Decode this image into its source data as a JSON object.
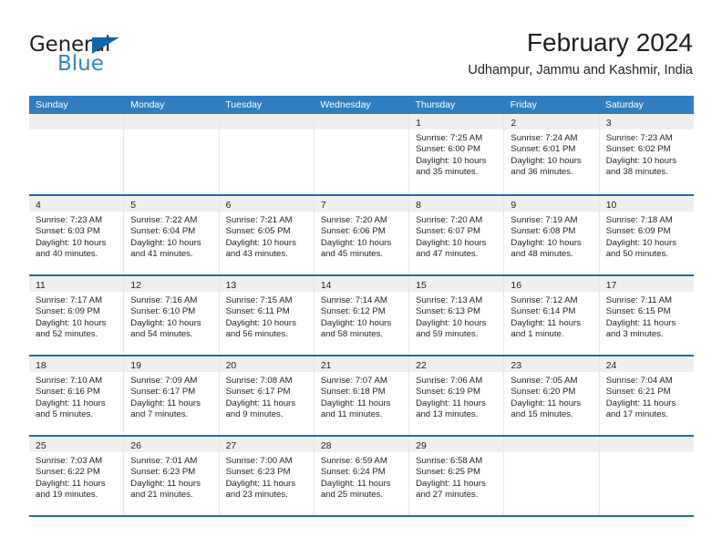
{
  "brand": {
    "name_top": "General",
    "name_bottom": "Blue",
    "triangle_color": "#1265a8",
    "blue_text_color": "#2a86d4"
  },
  "header": {
    "title": "February 2024",
    "subtitle": "Udhampur, Jammu and Kashmir, India"
  },
  "theme": {
    "header_bar": "#2f7ec1",
    "row_rule": "#1f6cb4",
    "day_head_bg": "#efefef",
    "text": "#231f20"
  },
  "weekdays": [
    "Sunday",
    "Monday",
    "Tuesday",
    "Wednesday",
    "Thursday",
    "Friday",
    "Saturday"
  ],
  "weeks": [
    [
      {
        "day": "",
        "lines": []
      },
      {
        "day": "",
        "lines": []
      },
      {
        "day": "",
        "lines": []
      },
      {
        "day": "",
        "lines": []
      },
      {
        "day": "1",
        "lines": [
          "Sunrise: 7:25 AM",
          "Sunset: 6:00 PM",
          "Daylight: 10 hours",
          "and 35 minutes."
        ]
      },
      {
        "day": "2",
        "lines": [
          "Sunrise: 7:24 AM",
          "Sunset: 6:01 PM",
          "Daylight: 10 hours",
          "and 36 minutes."
        ]
      },
      {
        "day": "3",
        "lines": [
          "Sunrise: 7:23 AM",
          "Sunset: 6:02 PM",
          "Daylight: 10 hours",
          "and 38 minutes."
        ]
      }
    ],
    [
      {
        "day": "4",
        "lines": [
          "Sunrise: 7:23 AM",
          "Sunset: 6:03 PM",
          "Daylight: 10 hours",
          "and 40 minutes."
        ]
      },
      {
        "day": "5",
        "lines": [
          "Sunrise: 7:22 AM",
          "Sunset: 6:04 PM",
          "Daylight: 10 hours",
          "and 41 minutes."
        ]
      },
      {
        "day": "6",
        "lines": [
          "Sunrise: 7:21 AM",
          "Sunset: 6:05 PM",
          "Daylight: 10 hours",
          "and 43 minutes."
        ]
      },
      {
        "day": "7",
        "lines": [
          "Sunrise: 7:20 AM",
          "Sunset: 6:06 PM",
          "Daylight: 10 hours",
          "and 45 minutes."
        ]
      },
      {
        "day": "8",
        "lines": [
          "Sunrise: 7:20 AM",
          "Sunset: 6:07 PM",
          "Daylight: 10 hours",
          "and 47 minutes."
        ]
      },
      {
        "day": "9",
        "lines": [
          "Sunrise: 7:19 AM",
          "Sunset: 6:08 PM",
          "Daylight: 10 hours",
          "and 48 minutes."
        ]
      },
      {
        "day": "10",
        "lines": [
          "Sunrise: 7:18 AM",
          "Sunset: 6:09 PM",
          "Daylight: 10 hours",
          "and 50 minutes."
        ]
      }
    ],
    [
      {
        "day": "11",
        "lines": [
          "Sunrise: 7:17 AM",
          "Sunset: 6:09 PM",
          "Daylight: 10 hours",
          "and 52 minutes."
        ]
      },
      {
        "day": "12",
        "lines": [
          "Sunrise: 7:16 AM",
          "Sunset: 6:10 PM",
          "Daylight: 10 hours",
          "and 54 minutes."
        ]
      },
      {
        "day": "13",
        "lines": [
          "Sunrise: 7:15 AM",
          "Sunset: 6:11 PM",
          "Daylight: 10 hours",
          "and 56 minutes."
        ]
      },
      {
        "day": "14",
        "lines": [
          "Sunrise: 7:14 AM",
          "Sunset: 6:12 PM",
          "Daylight: 10 hours",
          "and 58 minutes."
        ]
      },
      {
        "day": "15",
        "lines": [
          "Sunrise: 7:13 AM",
          "Sunset: 6:13 PM",
          "Daylight: 10 hours",
          "and 59 minutes."
        ]
      },
      {
        "day": "16",
        "lines": [
          "Sunrise: 7:12 AM",
          "Sunset: 6:14 PM",
          "Daylight: 11 hours",
          "and 1 minute."
        ]
      },
      {
        "day": "17",
        "lines": [
          "Sunrise: 7:11 AM",
          "Sunset: 6:15 PM",
          "Daylight: 11 hours",
          "and 3 minutes."
        ]
      }
    ],
    [
      {
        "day": "18",
        "lines": [
          "Sunrise: 7:10 AM",
          "Sunset: 6:16 PM",
          "Daylight: 11 hours",
          "and 5 minutes."
        ]
      },
      {
        "day": "19",
        "lines": [
          "Sunrise: 7:09 AM",
          "Sunset: 6:17 PM",
          "Daylight: 11 hours",
          "and 7 minutes."
        ]
      },
      {
        "day": "20",
        "lines": [
          "Sunrise: 7:08 AM",
          "Sunset: 6:17 PM",
          "Daylight: 11 hours",
          "and 9 minutes."
        ]
      },
      {
        "day": "21",
        "lines": [
          "Sunrise: 7:07 AM",
          "Sunset: 6:18 PM",
          "Daylight: 11 hours",
          "and 11 minutes."
        ]
      },
      {
        "day": "22",
        "lines": [
          "Sunrise: 7:06 AM",
          "Sunset: 6:19 PM",
          "Daylight: 11 hours",
          "and 13 minutes."
        ]
      },
      {
        "day": "23",
        "lines": [
          "Sunrise: 7:05 AM",
          "Sunset: 6:20 PM",
          "Daylight: 11 hours",
          "and 15 minutes."
        ]
      },
      {
        "day": "24",
        "lines": [
          "Sunrise: 7:04 AM",
          "Sunset: 6:21 PM",
          "Daylight: 11 hours",
          "and 17 minutes."
        ]
      }
    ],
    [
      {
        "day": "25",
        "lines": [
          "Sunrise: 7:03 AM",
          "Sunset: 6:22 PM",
          "Daylight: 11 hours",
          "and 19 minutes."
        ]
      },
      {
        "day": "26",
        "lines": [
          "Sunrise: 7:01 AM",
          "Sunset: 6:23 PM",
          "Daylight: 11 hours",
          "and 21 minutes."
        ]
      },
      {
        "day": "27",
        "lines": [
          "Sunrise: 7:00 AM",
          "Sunset: 6:23 PM",
          "Daylight: 11 hours",
          "and 23 minutes."
        ]
      },
      {
        "day": "28",
        "lines": [
          "Sunrise: 6:59 AM",
          "Sunset: 6:24 PM",
          "Daylight: 11 hours",
          "and 25 minutes."
        ]
      },
      {
        "day": "29",
        "lines": [
          "Sunrise: 6:58 AM",
          "Sunset: 6:25 PM",
          "Daylight: 11 hours",
          "and 27 minutes."
        ]
      },
      {
        "day": "",
        "lines": []
      },
      {
        "day": "",
        "lines": []
      }
    ]
  ]
}
